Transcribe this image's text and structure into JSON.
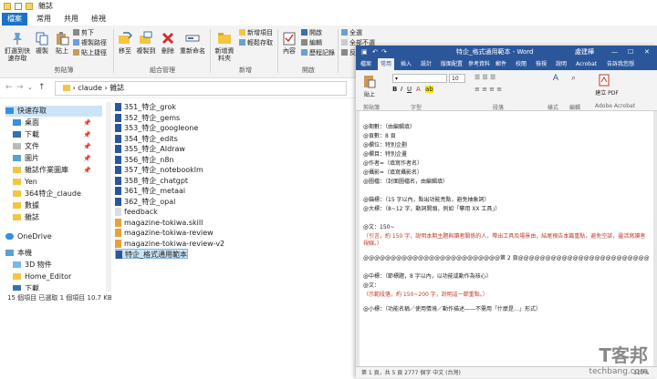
{
  "explorer": {
    "title": "雜誌",
    "tabs": [
      "檔案",
      "常用",
      "共用",
      "檢視"
    ],
    "ribbon": {
      "pin_label": "釘選到快速存取",
      "copy_label": "複製",
      "paste_label": "貼上",
      "cut_label": "剪下",
      "copy_path_label": "複製路徑",
      "paste_shortcut_label": "貼上捷徑",
      "clipboard_group": "剪貼簿",
      "move_label": "移至",
      "copyto_label": "複製到",
      "delete_label": "刪除",
      "rename_label": "重新命名",
      "organize_group": "組合管理",
      "newfolder_label": "新增資料夾",
      "newitem_label": "新增項目",
      "easyaccess_label": "輕鬆存取",
      "new_group": "新增",
      "props_label": "內容",
      "open_label": "開啟",
      "edit_label": "編輯",
      "history_label": "歷程記錄",
      "open_group": "開啟",
      "selectall_label": "全選",
      "selectnone_label": "全部不選",
      "invert_label": "反向選擇"
    },
    "address": {
      "path1": "claude",
      "path2": "雜誌"
    },
    "nav": [
      {
        "label": "快速存取",
        "pin": false
      },
      {
        "label": "桌面",
        "pin": true
      },
      {
        "label": "下載",
        "pin": true
      },
      {
        "label": "文件",
        "pin": true
      },
      {
        "label": "圖片",
        "pin": true
      },
      {
        "label": "雜誌作業圖庫",
        "pin": true
      },
      {
        "label": "Yen",
        "pin": false
      },
      {
        "label": "364特企_claude",
        "pin": false
      },
      {
        "label": "數據",
        "pin": false
      },
      {
        "label": "雜誌",
        "pin": false
      },
      {
        "label": "OneDrive",
        "pin": false
      },
      {
        "label": "本機",
        "pin": false
      },
      {
        "label": "3D 物件",
        "pin": false
      },
      {
        "label": "Home_Editor",
        "pin": false
      },
      {
        "label": "下載",
        "pin": false
      }
    ],
    "files": [
      "351_特企_grok",
      "352_特企_gems",
      "353_特企_googleone",
      "354_特企_edits",
      "355_特企_AIdraw",
      "356_特企_n8n",
      "357_特企_notebooklm",
      "358_特企_chatgpt",
      "361_特企_metaai",
      "362_特企_opal",
      "feedback",
      "magazine-tokiwa.skill",
      "magazine-tokiwa-review",
      "magazine-tokiwa-review-v2",
      "特企_格式通用範本"
    ],
    "status": "15 個項目    已選取 1 個項目  10.7 KB"
  },
  "word": {
    "title": "特企_格式通用範本 - Word",
    "user": "盧建樺",
    "tabs": [
      "檔案",
      "常用",
      "插入",
      "設計",
      "版面配置",
      "參考資料",
      "郵件",
      "校閱",
      "檢視",
      "說明",
      "Acrobat",
      "告訴我您想"
    ],
    "ribbon_labels": [
      "貼上",
      "剪貼簿",
      "字型",
      "段落",
      "樣式",
      "編輯",
      "建立 PDF",
      "Adobe Acrobat"
    ],
    "font_size": "10",
    "lines": [
      {
        "t": "@期數：（由編輯填）",
        "red": false
      },
      {
        "t": "@頁數：8 頁",
        "red": false
      },
      {
        "t": "@欄位：特別企劃",
        "red": false
      },
      {
        "t": "@欄目：特別企畫",
        "red": false
      },
      {
        "t": "@作者=（填寫作者名）",
        "red": false
      },
      {
        "t": "@攝影=（填寫攝影名）",
        "red": false
      },
      {
        "t": "@圖檔：（封面圖檔名，由編輯填）",
        "red": false
      },
      {
        "t": "@錨標：（15 字以內，點出功能亮點，避免抽象詞）",
        "red": false
      },
      {
        "t": "@大標：（8~12 字，動詞開頭，例如「攀用 XX 工具」）",
        "red": false
      },
      {
        "t": "@文：150~",
        "red": false
      },
      {
        "t": "（引言，約 150 字，說明本期主題與讀者關係的人，帶出工具及場景由，結尾預告本篇重點，避免空談，靈活寫讀者視線。）",
        "red": true
      },
      {
        "t": "@@@@@@@@@@@@@@@@@@@@@@@@@第 2 頁@@@@@@@@@@@@@@@@@@@@@@@@",
        "red": false
      },
      {
        "t": "@中標：（節標題，8 字以內，以功能或動作為核心）",
        "red": false
      },
      {
        "t": "@文：",
        "red": false
      },
      {
        "t": "（示範段落，約 150~200 字，說明這一節重點。）",
        "red": true
      },
      {
        "t": "@小標：（功能名稱／使用情境／動作描述——不需用「什麼是…」形式）",
        "red": false
      }
    ],
    "status": "第 1 頁，共 5 頁   2777 個字   中文 (台灣)",
    "zoom": "110%"
  },
  "watermark": {
    "logo": "T客邦",
    "site": "techbang.com"
  }
}
